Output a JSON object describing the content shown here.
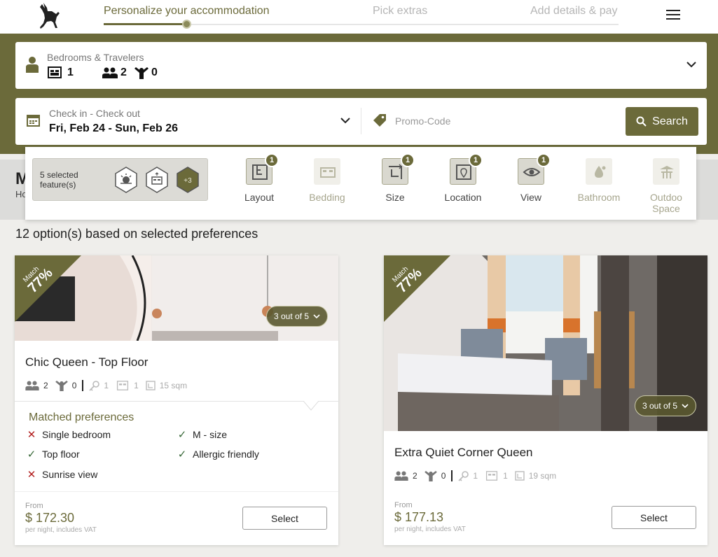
{
  "header": {
    "steps": [
      "Personalize your accommodation",
      "Pick extras",
      "Add details & pay"
    ]
  },
  "travelers": {
    "label": "Bedrooms & Travelers",
    "bedrooms": "1",
    "adults": "2",
    "children": "0"
  },
  "dates": {
    "label": "Check in - Check out",
    "value": "Fri, Feb 24 - Sun, Feb 26",
    "promo_placeholder": "Promo-Code",
    "search_label": "Search"
  },
  "section": {
    "title": "M",
    "subtitle": "Ho"
  },
  "features": {
    "selected_text": "5 selected feature(s)",
    "more_label": "+3",
    "items": [
      {
        "label": "Layout",
        "count": "1",
        "active": true
      },
      {
        "label": "Bedding",
        "count": "",
        "active": false
      },
      {
        "label": "Size",
        "count": "1",
        "active": true
      },
      {
        "label": "Location",
        "count": "1",
        "active": true
      },
      {
        "label": "View",
        "count": "1",
        "active": true
      },
      {
        "label": "Bathroom",
        "count": "",
        "active": false
      },
      {
        "label": "Outdoo Space",
        "count": "",
        "active": false
      }
    ]
  },
  "results": {
    "count_text": "12 option(s) based on selected preferences"
  },
  "rooms": [
    {
      "match_label": "Match",
      "match_value": "77%",
      "photos_label": "3 out of 5",
      "title": "Chic Queen - Top Floor",
      "adults": "2",
      "children": "0",
      "keys": "1",
      "beds": "1",
      "size": "15 sqm",
      "matched_title": "Matched preferences",
      "prefs": [
        {
          "label": "Single bedroom",
          "ok": false
        },
        {
          "label": "M - size",
          "ok": true
        },
        {
          "label": "Top floor",
          "ok": true
        },
        {
          "label": "Allergic friendly",
          "ok": true
        },
        {
          "label": "Sunrise view",
          "ok": false
        }
      ],
      "from_label": "From",
      "price": "$ 172.30",
      "price_note": "per night, includes VAT",
      "select_label": "Select"
    },
    {
      "match_label": "Match",
      "match_value": "77%",
      "photos_label": "3 out of 5",
      "title": "Extra Quiet Corner Queen",
      "adults": "2",
      "children": "0",
      "keys": "1",
      "beds": "1",
      "size": "19 sqm",
      "from_label": "From",
      "price": "$ 177.13",
      "price_note": "per night, includes VAT",
      "select_label": "Select"
    }
  ],
  "colors": {
    "brand": "#6b6a3a",
    "error": "#b32020",
    "ok": "#3a6a3a"
  },
  "icons": [
    "deer-logo-icon",
    "menu-icon",
    "person-icon",
    "bed-icon",
    "adults-icon",
    "child-icon",
    "chevron-down-icon",
    "calendar-icon",
    "tag-icon",
    "search-icon"
  ]
}
